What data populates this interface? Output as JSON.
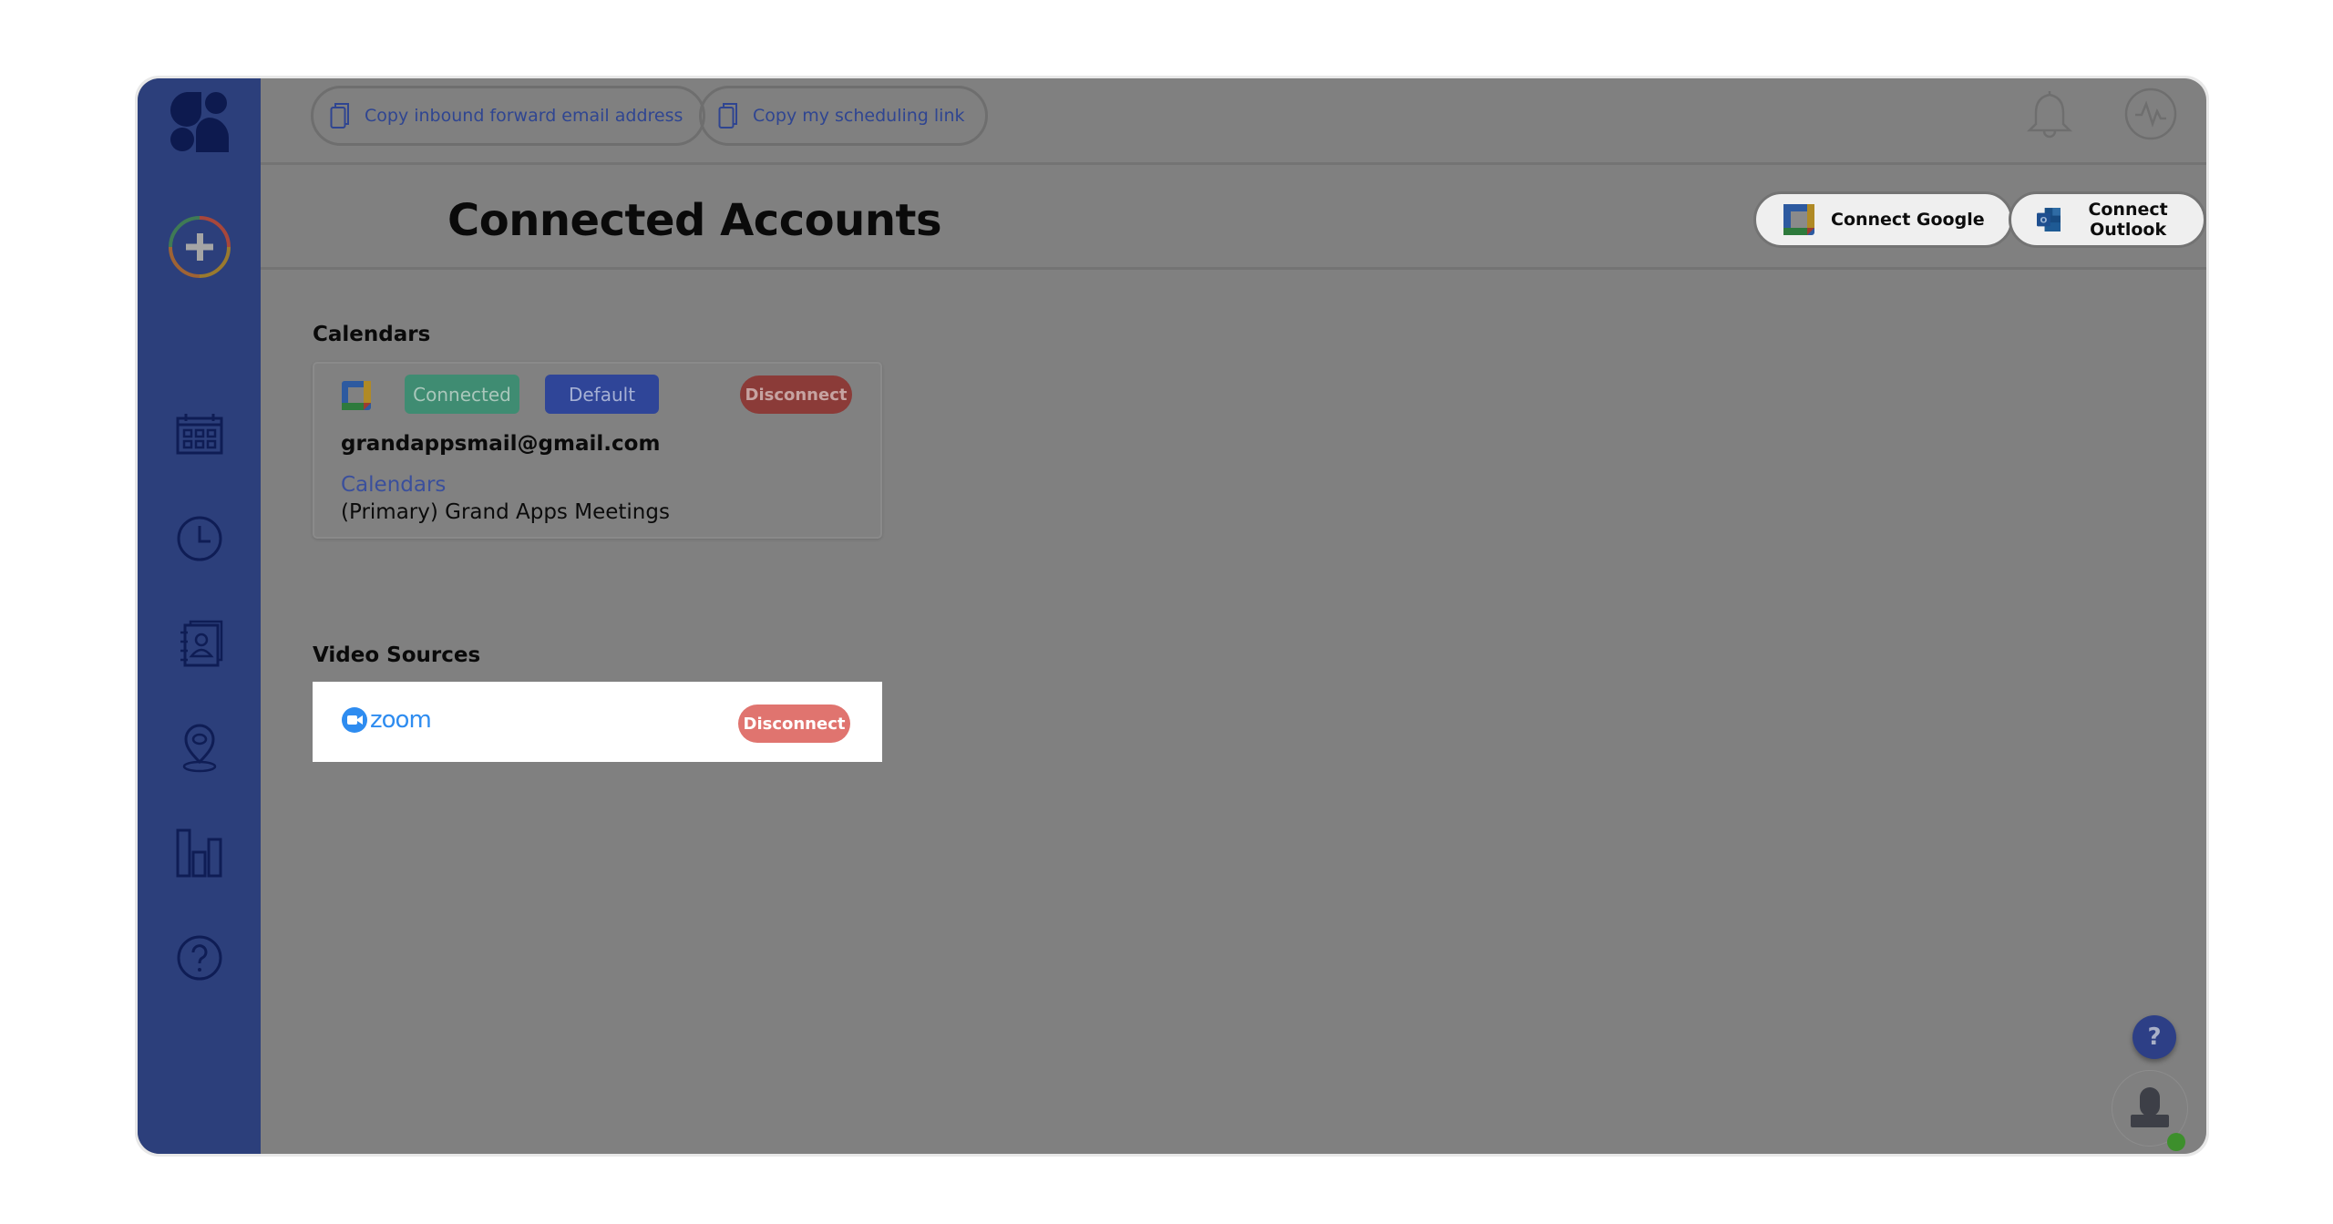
{
  "header": {
    "copy_forward_email_label": "Copy inbound forward email address",
    "copy_scheduling_link_label": "Copy my scheduling link"
  },
  "page": {
    "title": "Connected Accounts",
    "connect_google_label": "Connect Google",
    "connect_outlook_label": "Connect Outlook"
  },
  "sidebar": {
    "items": [
      {
        "icon": "add-icon"
      },
      {
        "icon": "calendar-icon"
      },
      {
        "icon": "clock-icon"
      },
      {
        "icon": "contacts-icon"
      },
      {
        "icon": "location-pin-icon"
      },
      {
        "icon": "bar-chart-icon"
      },
      {
        "icon": "help-icon"
      }
    ]
  },
  "calendars": {
    "section_label": "Calendars",
    "account": {
      "provider": "Google Calendar",
      "status_badge": "Connected",
      "default_badge": "Default",
      "disconnect_label": "Disconnect",
      "email": "grandappsmail@gmail.com",
      "calendars_link": "Calendars",
      "calendar_name": "(Primary) Grand Apps Meetings"
    }
  },
  "video_sources": {
    "section_label": "Video Sources",
    "source": {
      "provider": "zoom",
      "disconnect_label": "Disconnect"
    }
  },
  "floating": {
    "help_label": "?"
  },
  "colors": {
    "sidebar": "#2c3f7b",
    "overlay_bg": "#808080",
    "connected": "#3f8c72",
    "default": "#2f4598",
    "disconnect_dim": "#8b3b38",
    "disconnect": "#e0746f",
    "link": "#3a4f9c",
    "online": "#3d8f2c"
  }
}
